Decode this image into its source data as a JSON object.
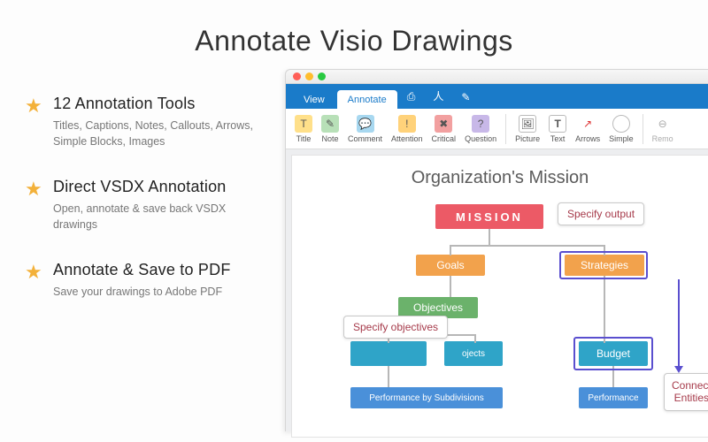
{
  "title": "Annotate Visio Drawings",
  "features": [
    {
      "title": "12 Annotation Tools",
      "desc": "Titles, Captions, Notes, Callouts, Arrows, Simple Blocks, Images"
    },
    {
      "title": "Direct VSDX Annotation",
      "desc": "Open, annotate & save back VSDX drawings"
    },
    {
      "title": "Annotate & Save to PDF",
      "desc": "Save your drawings to Adobe PDF"
    }
  ],
  "tabs": {
    "view": "View",
    "annotate": "Annotate"
  },
  "tools": {
    "title": "Title",
    "note": "Note",
    "comment": "Comment",
    "attention": "Attention",
    "critical": "Critical",
    "question": "Question",
    "picture": "Picture",
    "text": "Text",
    "arrows": "Arrows",
    "simple": "Simple",
    "remove": "Remo"
  },
  "canvas": {
    "title": "Organization's Mission",
    "nodes": {
      "mission": "MISSION",
      "goals": "Goals",
      "strategies": "Strategies",
      "objectives": "Objectives",
      "orgsub": "",
      "projects": "ojects",
      "budget": "Budget",
      "perfsub": "Performance by Subdivisions",
      "perf": "Performance"
    },
    "notes": {
      "n1": "Specify output",
      "n2": "Specify objectives",
      "n3": "Connect\nEntities"
    }
  }
}
